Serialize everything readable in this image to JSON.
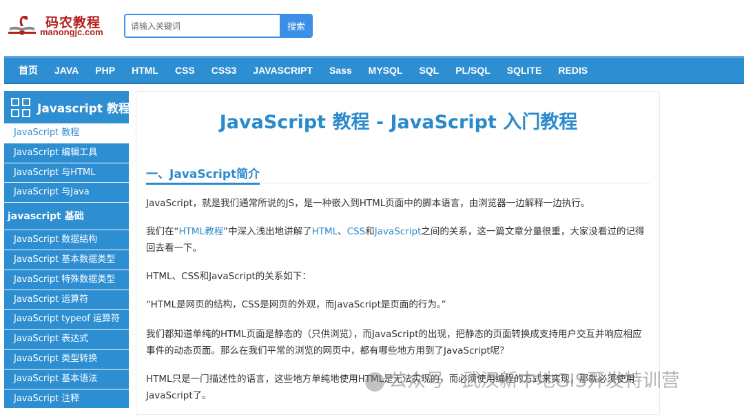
{
  "logo": {
    "cn": "码农教程",
    "en": "manongjc.com"
  },
  "search": {
    "placeholder": "请输入关键词",
    "button_label": "搜索"
  },
  "nav": [
    "首页",
    "JAVA",
    "PHP",
    "HTML",
    "CSS",
    "CSS3",
    "JAVASCRIPT",
    "Sass",
    "MYSQL",
    "SQL",
    "PL/SQL",
    "SQLITE",
    "REDIS"
  ],
  "sidebar": {
    "title": "Javascript 教程",
    "items_top": [
      "JavaScript 教程",
      "JavaScript 编辑工具",
      "JavaScript 与HTML",
      "JavaScript 与Java"
    ],
    "group": "javascript 基础",
    "items_basic": [
      "JavaScript 数据结构",
      "JavaScript 基本数据类型",
      "JavaScript 特殊数据类型",
      "JavaScript 运算符",
      "JavaScript typeof 运算符",
      "JavaScript 表达式",
      "JavaScript 类型转换",
      "JavaScript 基本语法",
      "JavaScript 注释"
    ]
  },
  "main": {
    "title": "JavaScript 教程 - JavaScript 入门教程",
    "section": "一、JavaScript简介",
    "p1": "JavaScript，就是我们通常所说的JS，是一种嵌入到HTML页面中的脚本语言，由浏览器一边解释一边执行。",
    "p2": {
      "a": "我们在“",
      "link1": "HTML教程",
      "b": "”中深入浅出地讲解了",
      "link2": "HTML",
      "c": "、",
      "link3": "CSS",
      "d": "和",
      "link4": "JavaScript",
      "e": "之间的关系，这一篇文章分量很重，大家没看过的记得回去看一下。"
    },
    "p3": "HTML、CSS和JavaScript的关系如下：",
    "p4": "“HTML是网页的结构，CSS是网页的外观，而JavaScript是页面的行为。”",
    "p5": "我们都知道单纯的HTML页面是静态的（只供浏览），而JavaScript的出现，把静态的页面转换成支持用户交互并响应相应事件的动态页面。那么在我们平常的浏览的网页中，都有哪些地方用到了JavaScript呢？",
    "p6": "HTML只是一门描述性的语言，这些地方单纯地使用HTML是无法实现的，而必须使用编程的方式来实现，那就必须使用JavaScript了。"
  },
  "watermark": "公众号 · 武汉新中地GIS开发特训营",
  "colors": {
    "accent": "#2e8ed2",
    "brand": "#b3211d"
  }
}
